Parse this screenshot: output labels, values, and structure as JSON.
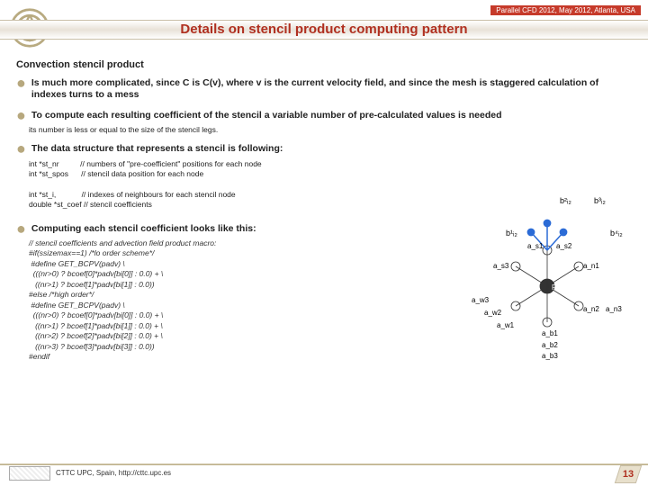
{
  "header": {
    "venue": "Parallel CFD 2012, May 2012, Atlanta, USA"
  },
  "title": "Details on stencil product computing pattern",
  "section_head": "Convection stencil product",
  "bullets": {
    "b1": "Is much more complicated, since C is C(v), where v is the current velocity field, and since the mesh is staggered calculation of indexes turns to a mess",
    "b2": "To compute each resulting coefficient of the stencil a variable number of pre-calculated values is needed",
    "b2_sub": "its number is less or equal to the size of the stencil legs.",
    "b3": "The data structure that represents a stencil is following:",
    "b4": "Computing each stencil coefficient looks like this:"
  },
  "code1": "int *st_nr          // numbers of \"pre-coefficient\" positions for each node\nint *st_spos      // stencil data position for each node\n\nint *st_i,            // indexes of neighbours for each stencil node\ndouble *st_coef // stencil coefficients",
  "code2": "// stencil coefficients and advection field product macro:\n#if(ssizemax==1) /*lo order scheme*/\n #define GET_BCPV(padv) \\\n  (((nr>0) ? bcoef[0]*padv[bi[0]] : 0.0) + \\\n   ((nr>1) ? bcoef[1]*padv[bi[1]] : 0.0))\n#else /*high order*/\n #define GET_BCPV(padv) \\\n  (((nr>0) ? bcoef[0]*padv[bi[0]] : 0.0) + \\\n   ((nr>1) ? bcoef[1]*padv[bi[1]] : 0.0) + \\\n   ((nr>2) ? bcoef[2]*padv[bi[2]] : 0.0) + \\\n   ((nr>3) ? bcoef[3]*padv[bi[3]] : 0.0))\n#endif",
  "diagram_labels": {
    "center": "P",
    "top": [
      "b²ᵢ₂",
      "b³ᵢ₂",
      "b¹ᵢ₂",
      "b⁴ᵢ₂"
    ],
    "inner": [
      "a_s1",
      "a_s2",
      "a_s3",
      "a_n1",
      "a_n2",
      "a_n3"
    ],
    "arrows": [
      "a_w1",
      "a_w2",
      "a_w3",
      "a_b1",
      "a_b2",
      "a_b3"
    ]
  },
  "footer": {
    "text": "CTTC UPC, Spain, http://cttc.upc.es",
    "page": "13"
  }
}
